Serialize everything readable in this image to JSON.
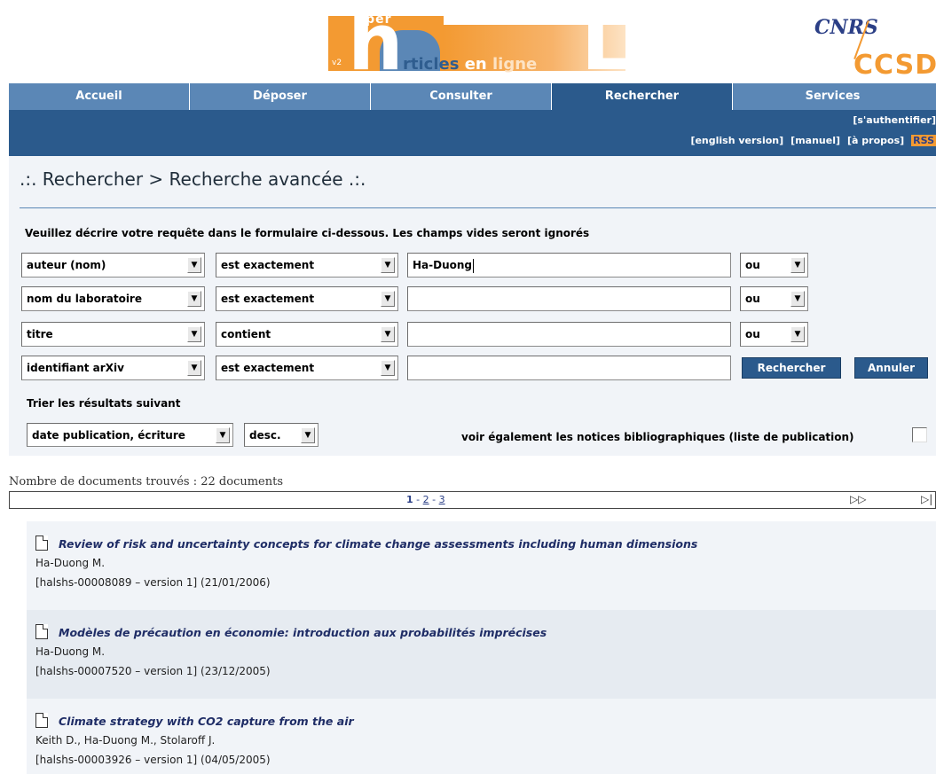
{
  "logo": {
    "hal_yper": "yper",
    "hal_v2": "v2",
    "hal_articles": "rticles",
    "hal_en": "en",
    "hal_ligne": "ligne",
    "cnrs": "CNRS",
    "ccsd": "CCSD"
  },
  "nav": {
    "items": [
      {
        "label": "Accueil"
      },
      {
        "label": "Déposer"
      },
      {
        "label": "Consulter"
      },
      {
        "label": "Rechercher"
      },
      {
        "label": "Services"
      }
    ]
  },
  "subbar": {
    "auth": "[s'authentifier]",
    "links": [
      "[english version]",
      "[manuel]",
      "[à propos]",
      "RSS"
    ]
  },
  "page": {
    "title": ".:. Rechercher > Recherche avancée .:.",
    "instructions": "Veuillez décrire votre requête dans le formulaire ci-dessous. Les champs vides seront ignorés"
  },
  "search": {
    "rows": [
      {
        "field": "auteur (nom)",
        "operator": "est exactement",
        "value": "Ha-Duong",
        "conjunction": "ou"
      },
      {
        "field": "nom du laboratoire",
        "operator": "est exactement",
        "value": "",
        "conjunction": "ou"
      },
      {
        "field": "titre",
        "operator": "contient",
        "value": "",
        "conjunction": "ou"
      },
      {
        "field": "identifiant arXiv",
        "operator": "est exactement",
        "value": ""
      }
    ],
    "search_button": "Rechercher",
    "cancel_button": "Annuler"
  },
  "sort": {
    "label": "Trier les résultats suivant",
    "by": "date publication, écriture",
    "order": "desc.",
    "biblio_label": "voir également les notices bibliographiques (liste de publication)",
    "biblio_checked": false
  },
  "results": {
    "count_text": "Nombre de documents trouvés : 22 documents",
    "pager": {
      "current": "1",
      "sep": "-",
      "p2": "2",
      "p3": "3",
      "next": "▷▷",
      "last": "▷|"
    },
    "items": [
      {
        "title": "Review of risk and uncertainty concepts for climate change assessments including human dimensions",
        "authors": "Ha-Duong M.",
        "meta": "[halshs-00008089 – version 1] (21/01/2006)"
      },
      {
        "title": "Modèles de précaution en économie: introduction aux probabilités imprécises",
        "authors": "Ha-Duong M.",
        "meta": "[halshs-00007520 – version 1] (23/12/2005)"
      },
      {
        "title": "Climate strategy with CO2 capture from the air",
        "authors": "Keith D., Ha-Duong M., Stolaroff J.",
        "meta": "[halshs-00003926 – version 1] (04/05/2005)"
      }
    ]
  },
  "colors": {
    "nav": "#5b87b6",
    "nav_active": "#2b5a8c",
    "accent": "#f39a32"
  }
}
